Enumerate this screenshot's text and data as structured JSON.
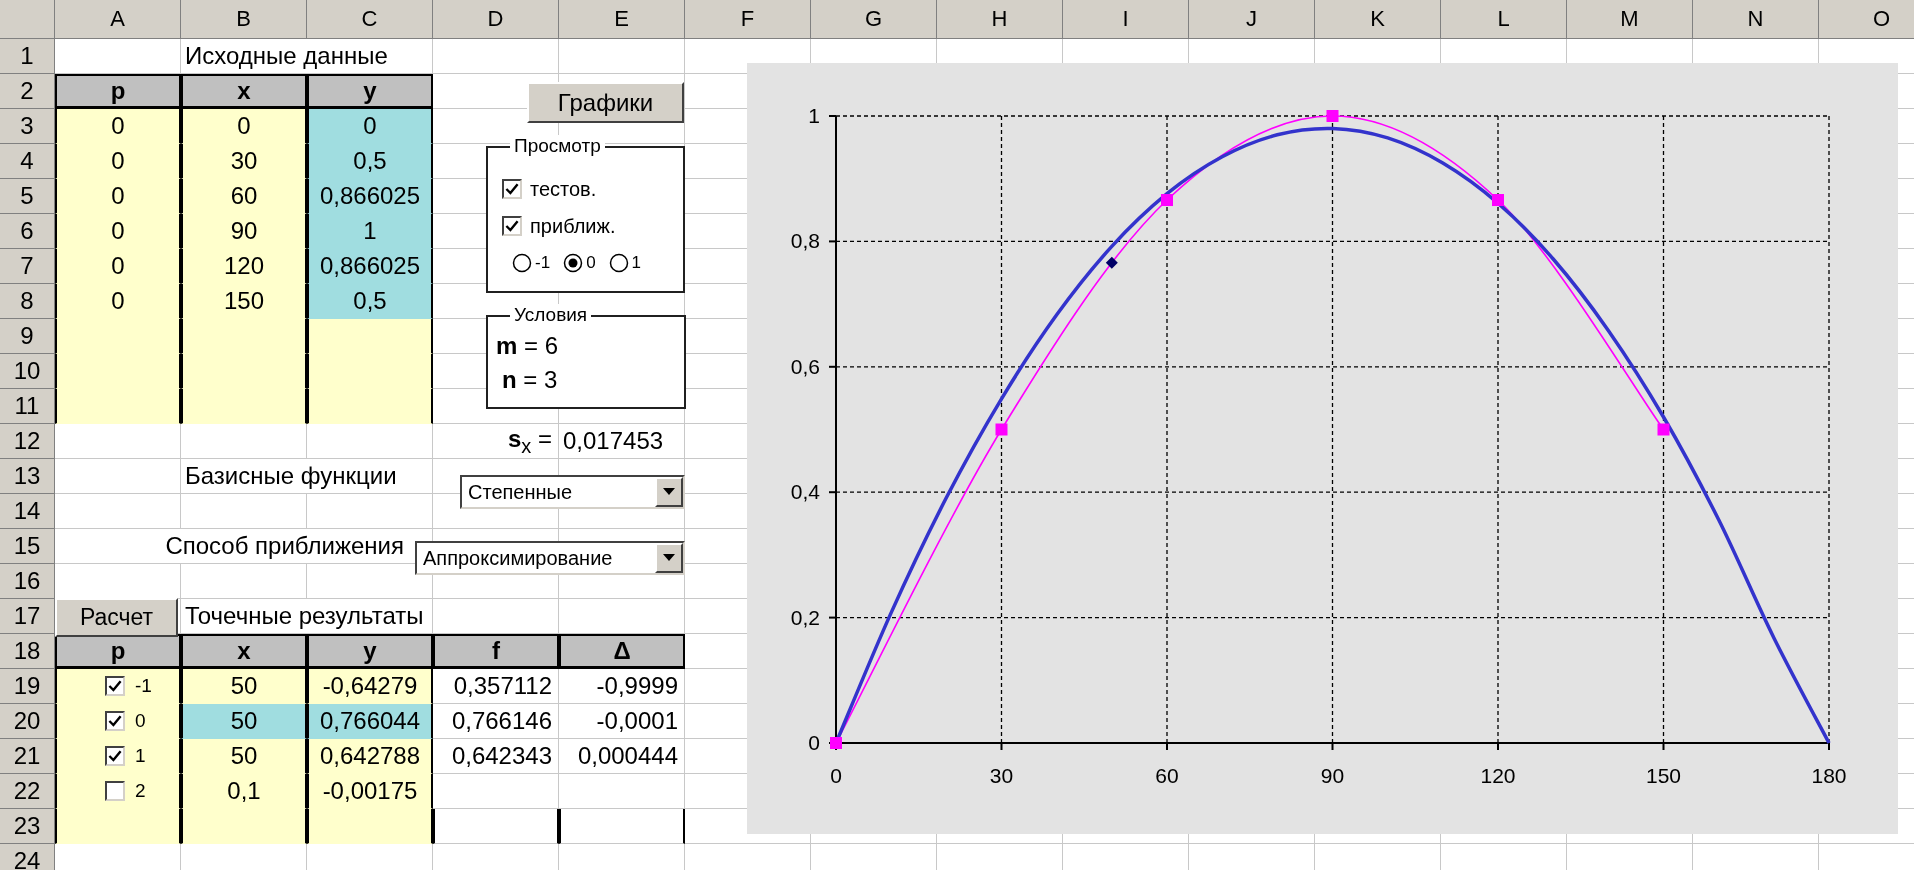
{
  "sheet": {
    "columns": [
      "A",
      "B",
      "C",
      "D",
      "E",
      "F",
      "G",
      "H",
      "I",
      "J",
      "K",
      "L",
      "M",
      "N",
      "O"
    ],
    "row_numbers": [
      "1",
      "2",
      "3",
      "4",
      "5",
      "6",
      "7",
      "8",
      "9",
      "10",
      "11",
      "12",
      "13",
      "14",
      "15",
      "16",
      "17",
      "18",
      "19",
      "20",
      "21",
      "22",
      "23",
      "24"
    ]
  },
  "input_table": {
    "title": "Исходные данные",
    "headers": [
      "p",
      "x",
      "y"
    ],
    "rows": [
      [
        "0",
        "0",
        "0"
      ],
      [
        "0",
        "30",
        "0,5"
      ],
      [
        "0",
        "60",
        "0,866025"
      ],
      [
        "0",
        "90",
        "1"
      ],
      [
        "0",
        "120",
        "0,866025"
      ],
      [
        "0",
        "150",
        "0,5"
      ]
    ]
  },
  "graphs_button": {
    "label": "Графики"
  },
  "view_group": {
    "title": "Просмотр",
    "checkboxes": [
      {
        "label": "тестов.",
        "checked": true
      },
      {
        "label": "приближ.",
        "checked": true
      }
    ],
    "radios": [
      {
        "label": "-1",
        "selected": false
      },
      {
        "label": "0",
        "selected": true
      },
      {
        "label": "1",
        "selected": false
      }
    ]
  },
  "conditions_group": {
    "title": "Условия",
    "lines": [
      "**m** = 6",
      "**n** = 3"
    ]
  },
  "step": {
    "label": "**s**$_{x}$ =",
    "value": "0,017453"
  },
  "basis": {
    "label": "Базисные функции",
    "dropdown": "Степенные"
  },
  "method": {
    "label": "Способ приближения",
    "dropdown": "Аппроксимирование"
  },
  "calc_button": {
    "label": "Расчет"
  },
  "results": {
    "title": "Точечные результаты",
    "headers": [
      "p",
      "x",
      "y",
      "f",
      "Δ"
    ],
    "rows": [
      {
        "checked": true,
        "selected": false,
        "cells": [
          "-1",
          "50",
          "-0,64279",
          "0,357112",
          "-0,9999"
        ]
      },
      {
        "checked": true,
        "selected": true,
        "cells": [
          "0",
          "50",
          "0,766044",
          "0,766146",
          "-0,0001"
        ]
      },
      {
        "checked": true,
        "selected": false,
        "cells": [
          "1",
          "50",
          "0,642788",
          "0,642343",
          "0,000444"
        ]
      },
      {
        "checked": false,
        "selected": false,
        "cells": [
          "2",
          "0,1",
          "-0,00175"
        ]
      }
    ]
  },
  "chart": {
    "chart_data": {
      "type": "line",
      "x": [
        0,
        10,
        20,
        30,
        40,
        50,
        60,
        70,
        80,
        90,
        100,
        110,
        120,
        130,
        140,
        150,
        160,
        170,
        180
      ],
      "xlim": [
        0,
        180
      ],
      "ylim": [
        0,
        1
      ],
      "grid": true,
      "xticks": [
        0,
        30,
        60,
        90,
        120,
        150,
        180
      ],
      "yticks": [
        {
          "value": 0,
          "label": "0"
        },
        {
          "value": 0.2,
          "label": "0,2"
        },
        {
          "value": 0.4,
          "label": "0,4"
        },
        {
          "value": 0.6,
          "label": "0,6"
        },
        {
          "value": 0.8,
          "label": "0,8"
        },
        {
          "value": 1,
          "label": "1"
        }
      ],
      "series": [
        {
          "color": "#ff00ff",
          "marker": "square",
          "values": [
            0,
            null,
            null,
            0.5,
            null,
            null,
            0.866,
            null,
            null,
            1,
            null,
            null,
            0.866,
            null,
            null,
            0.5,
            null,
            null,
            null
          ]
        },
        {
          "color": "#3333cc",
          "marker": "none",
          "values": [
            0,
            0.208,
            0.391,
            0.549,
            0.683,
            0.792,
            0.876,
            0.935,
            0.97,
            0.98,
            0.965,
            0.925,
            0.861,
            0.772,
            0.658,
            0.52,
            0.356,
            0.168,
            0
          ]
        },
        {
          "color": "#000066",
          "marker": "diamond",
          "values": [
            null,
            null,
            null,
            null,
            null,
            0.766,
            null,
            null,
            null,
            null,
            null,
            null,
            null,
            null,
            null,
            null,
            null,
            null,
            null
          ]
        }
      ]
    }
  }
}
